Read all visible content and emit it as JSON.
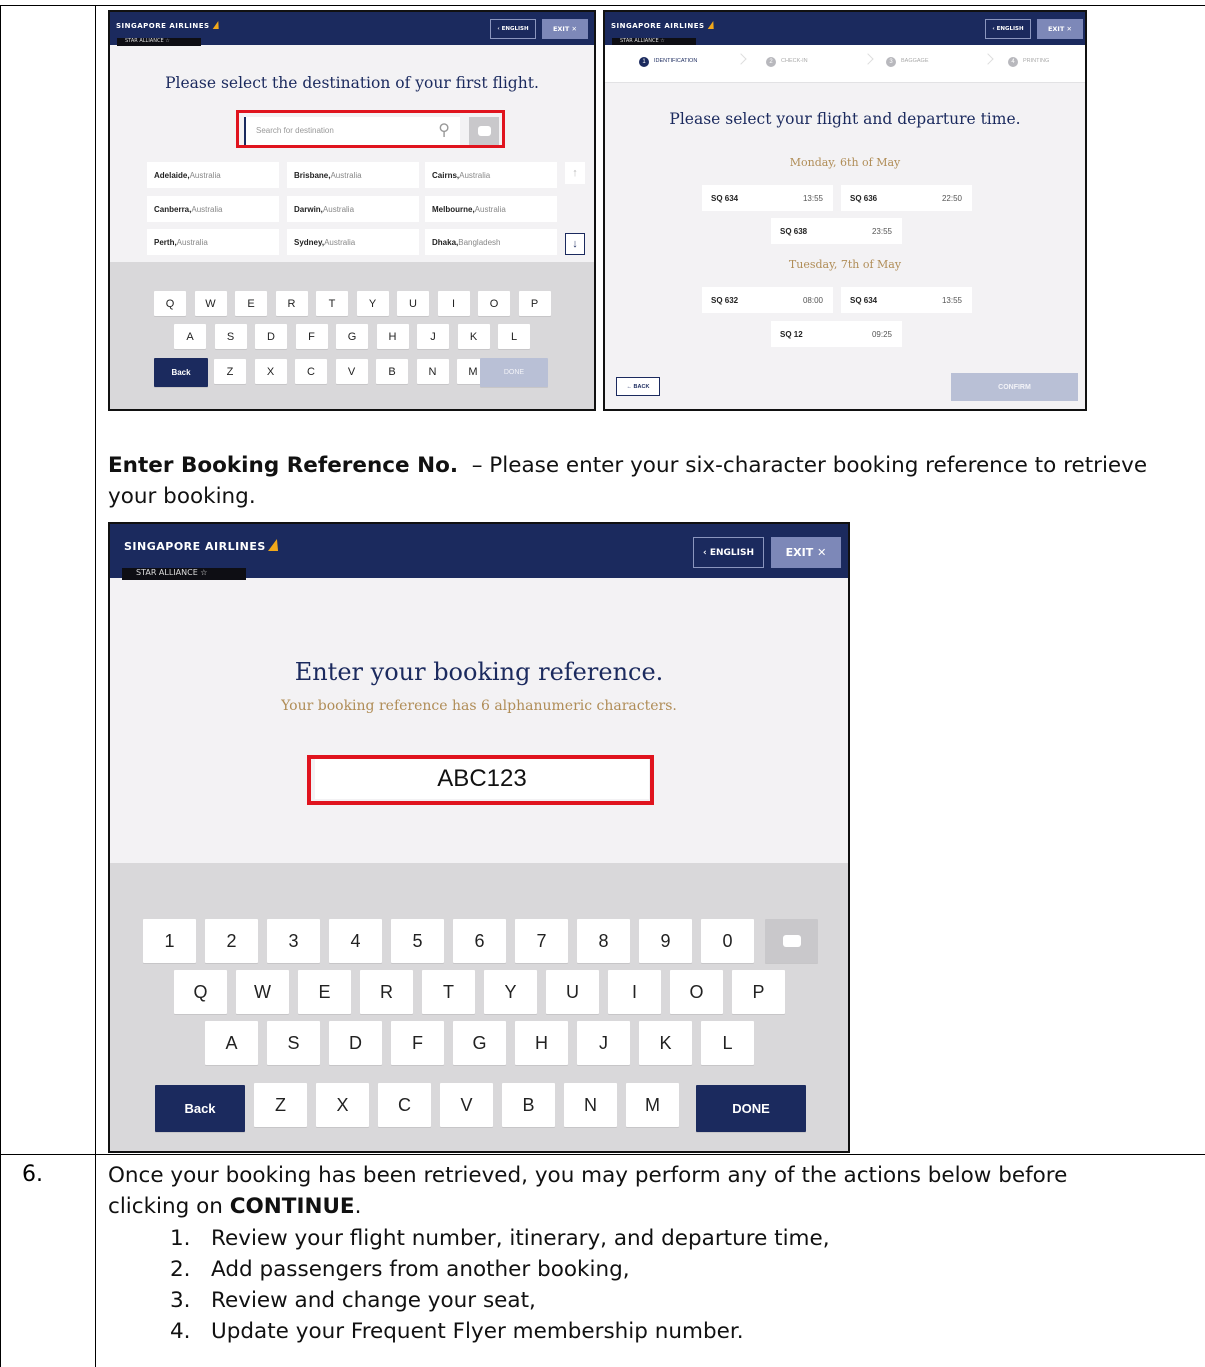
{
  "document": {
    "heading_bold": "Enter Booking Reference No.",
    "heading_rest": "– Please enter your six-character booking reference to retrieve your booking.",
    "step_number": "6.",
    "step_line1": "Once your booking has been retrieved, you may perform any of the actions below before",
    "step_line2_pre": "clicking on ",
    "step_line2_bold": "CONTINUE",
    "step_line2_post": ".",
    "list": [
      "1.   Review your flight number, itinerary, and departure time,",
      "2.   Add passengers from another booking,",
      "3.   Review and change your seat,",
      "4.   Update your Frequent Flyer membership number."
    ]
  },
  "kiosk_common": {
    "logo": "SINGAPORE AIRLINES",
    "alliance": "STAR ALLIANCE ☆",
    "lang_button": "‹ ENGLISH",
    "exit_button": "EXIT  ✕"
  },
  "screen1": {
    "title": "Please select the destination of your first flight.",
    "search_placeholder": "Search for destination",
    "destinations": [
      {
        "city": "Adelaide,",
        "country": " Australia"
      },
      {
        "city": "Brisbane,",
        "country": " Australia"
      },
      {
        "city": "Cairns,",
        "country": " Australia"
      },
      {
        "city": "Canberra,",
        "country": " Australia"
      },
      {
        "city": "Darwin,",
        "country": " Australia"
      },
      {
        "city": "Melbourne,",
        "country": " Australia"
      },
      {
        "city": "Perth,",
        "country": " Australia"
      },
      {
        "city": "Sydney,",
        "country": " Australia"
      },
      {
        "city": "Dhaka,",
        "country": " Bangladesh"
      }
    ],
    "up_arrow": "↑",
    "down_arrow": "↓",
    "keys_row1": [
      "Q",
      "W",
      "E",
      "R",
      "T",
      "Y",
      "U",
      "I",
      "O",
      "P"
    ],
    "keys_row2": [
      "A",
      "S",
      "D",
      "F",
      "G",
      "H",
      "J",
      "K",
      "L"
    ],
    "keys_row3": [
      "Z",
      "X",
      "C",
      "V",
      "B",
      "N",
      "M"
    ],
    "back": "Back",
    "done": "DONE"
  },
  "screen2": {
    "steps": [
      "IDENTIFICATION",
      "CHECK-IN",
      "BAGGAGE",
      "PRINTING"
    ],
    "step_numbers": [
      "1",
      "2",
      "3",
      "4"
    ],
    "title": "Please select your flight and departure time.",
    "day1": "Monday, 6th of May",
    "day2": "Tuesday, 7th of May",
    "flights_day1": [
      {
        "flight": "SQ 634",
        "time": "13:55"
      },
      {
        "flight": "SQ 636",
        "time": "22:50"
      },
      {
        "flight": "SQ 638",
        "time": "23:55"
      }
    ],
    "flights_day2": [
      {
        "flight": "SQ 632",
        "time": "08:00"
      },
      {
        "flight": "SQ 634",
        "time": "13:55"
      },
      {
        "flight": "SQ 12",
        "time": "09:25"
      }
    ],
    "back": "←  BACK",
    "confirm": "CONFIRM"
  },
  "screen3": {
    "title": "Enter your booking reference.",
    "subtitle": "Your booking reference has 6 alphanumeric characters.",
    "value": "ABC123",
    "keys_digits": [
      "1",
      "2",
      "3",
      "4",
      "5",
      "6",
      "7",
      "8",
      "9",
      "0"
    ],
    "keys_row1": [
      "Q",
      "W",
      "E",
      "R",
      "T",
      "Y",
      "U",
      "I",
      "O",
      "P"
    ],
    "keys_row2": [
      "A",
      "S",
      "D",
      "F",
      "G",
      "H",
      "J",
      "K",
      "L"
    ],
    "keys_row3": [
      "Z",
      "X",
      "C",
      "V",
      "B",
      "N",
      "M"
    ],
    "back": "Back",
    "done": "DONE"
  },
  "colors": {
    "navy": "#1b2a5e",
    "highlight_red": "#e0141e",
    "gold_text": "#b08d57"
  }
}
